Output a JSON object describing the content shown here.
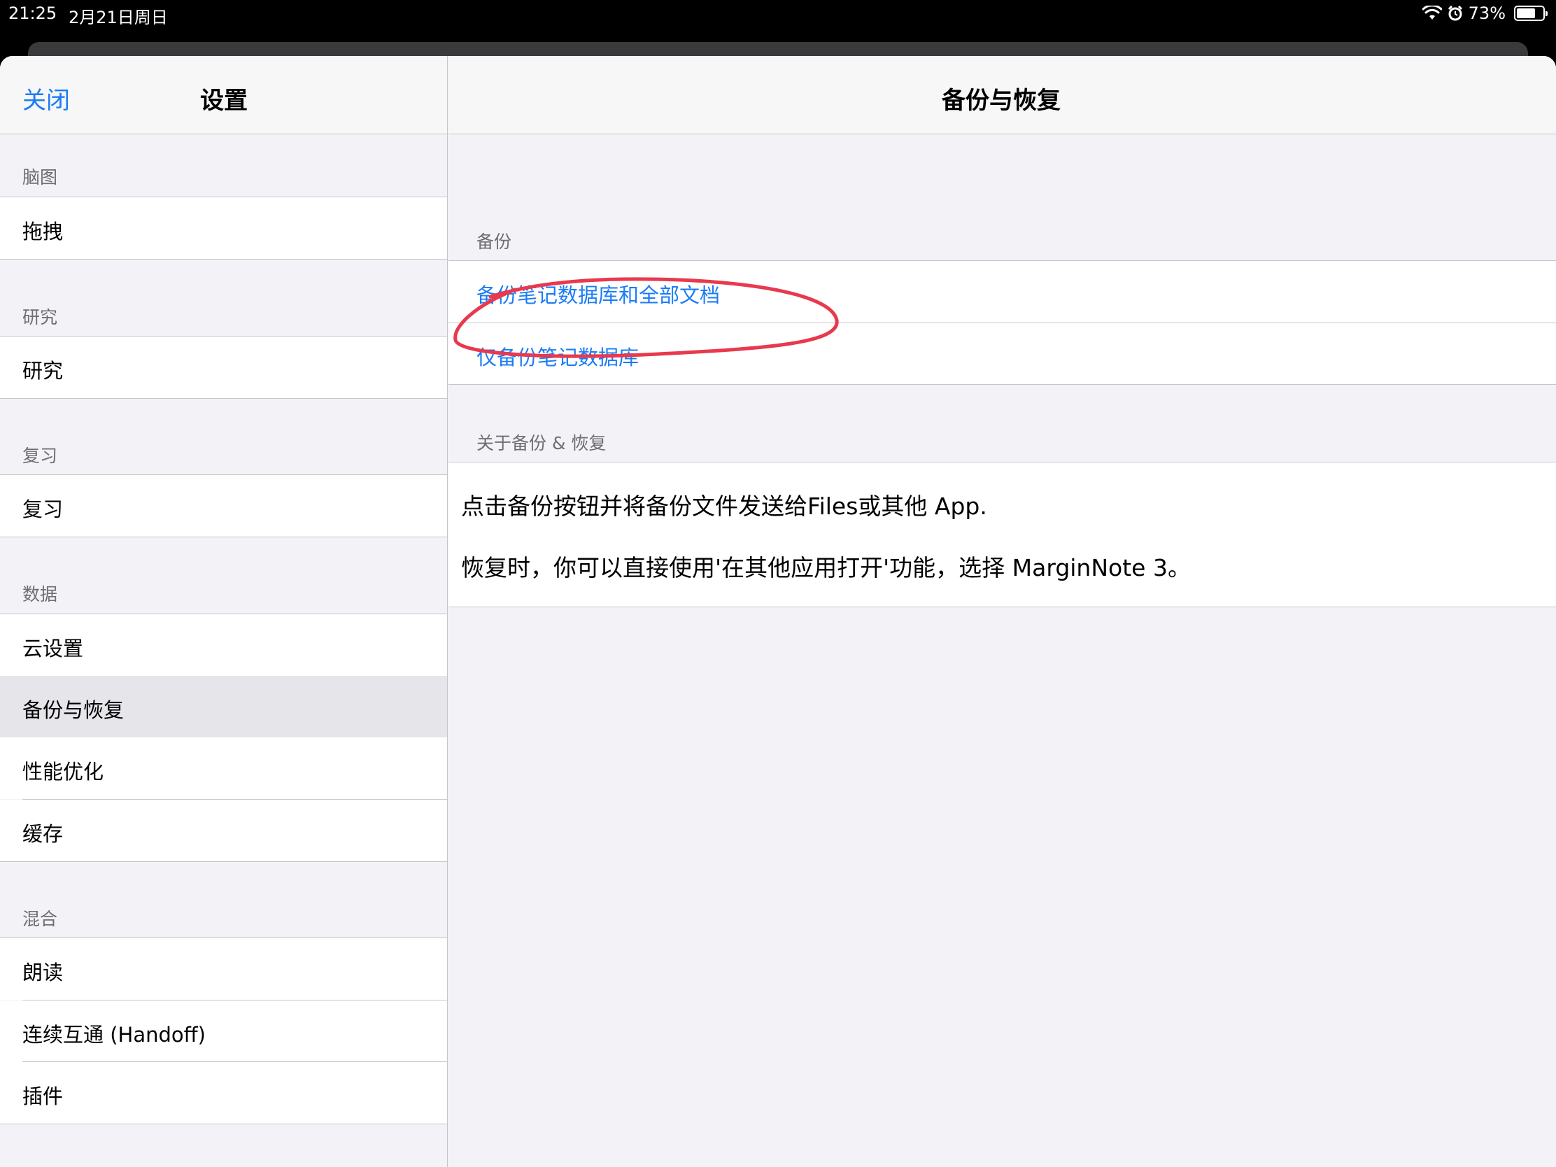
{
  "status_bar": {
    "time": "21:25",
    "date": "2月21日周日",
    "battery": "73%",
    "battery_level": 0.73
  },
  "sidebar": {
    "close_label": "关闭",
    "title": "设置",
    "sections": [
      {
        "header": "脑图",
        "items": [
          "拖拽"
        ]
      },
      {
        "header": "研究",
        "items": [
          "研究"
        ]
      },
      {
        "header": "复习",
        "items": [
          "复习"
        ]
      },
      {
        "header": "数据",
        "items": [
          "云设置",
          "备份与恢复",
          "性能优化",
          "缓存"
        ]
      },
      {
        "header": "混合",
        "items": [
          "朗读",
          "连续互通 (Handoff)",
          "插件"
        ]
      }
    ],
    "selected_item": "备份与恢复"
  },
  "detail": {
    "title": "备份与恢复",
    "backup_section": {
      "header": "备份",
      "items": [
        "备份笔记数据库和全部文档",
        "仅备份笔记数据库"
      ]
    },
    "about_section": {
      "header": "关于备份 & 恢复",
      "lines": [
        "点击备份按钮并将备份文件发送给Files或其他 App.",
        "恢复时，你可以直接使用'在其他应用打开'功能，选择 MarginNote 3。"
      ]
    }
  },
  "colors": {
    "accent": "#1a7cf5",
    "annotation": "#e8394d"
  }
}
